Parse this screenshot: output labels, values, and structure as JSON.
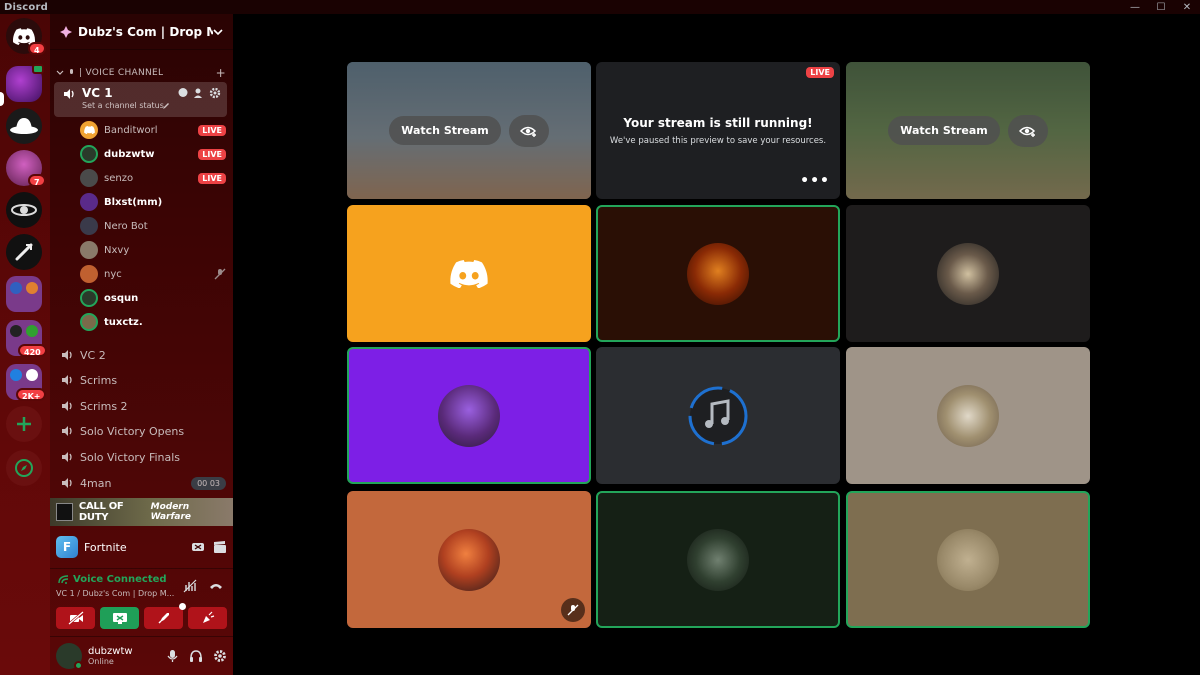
{
  "app": {
    "title": "Discord"
  },
  "servers": [
    {
      "name": "home",
      "badge": "4"
    },
    {
      "name": "server-2",
      "badge": ""
    },
    {
      "name": "server-3",
      "badge": ""
    },
    {
      "name": "server-4",
      "badge": "7"
    },
    {
      "name": "server-5",
      "badge": ""
    },
    {
      "name": "server-6",
      "badge": ""
    },
    {
      "name": "server-7",
      "badge": ""
    },
    {
      "name": "server-folder-1",
      "badge": "420"
    },
    {
      "name": "server-folder-2",
      "badge": "2K+"
    }
  ],
  "server_header": {
    "name": "Dubz's Com | Drop M..."
  },
  "category": {
    "label": "| VOICE CHANNEL"
  },
  "active_channel": {
    "name": "VC 1",
    "status": "Set a channel status"
  },
  "members": [
    {
      "name": "Banditworl",
      "live": "LIVE",
      "color": "#f0a232"
    },
    {
      "name": "dubzwtw",
      "live": "LIVE",
      "color": "#2a3a2a"
    },
    {
      "name": "senzo",
      "live": "LIVE",
      "color": "#4a4a4a"
    },
    {
      "name": "Blxst(mm)",
      "live": "",
      "color": "#5a2a8a"
    },
    {
      "name": "Nero Bot",
      "live": "",
      "color": "#3a3a4a"
    },
    {
      "name": "Nxvy",
      "live": "",
      "color": "#8a7a6a"
    },
    {
      "name": "nyc",
      "live": "",
      "color": "#c06030"
    },
    {
      "name": "osqun",
      "live": "",
      "color": "#2a3a2a"
    },
    {
      "name": "tuxctz.",
      "live": "",
      "color": "#7a6a4a"
    }
  ],
  "channels": [
    {
      "name": "VC 2"
    },
    {
      "name": "Scrims"
    },
    {
      "name": "Scrims 2"
    },
    {
      "name": "Solo Victory Opens"
    },
    {
      "name": "Solo Victory Finals"
    },
    {
      "name": "4man",
      "counts": "00 03"
    }
  ],
  "game_banner": {
    "title": "CALL OF DUTY",
    "subtitle": "Modern Warfare"
  },
  "activity": {
    "name": "Fortnite"
  },
  "voice": {
    "status": "Voice Connected",
    "channel": "VC 1 / Dubz's Com | Drop M..."
  },
  "user": {
    "name": "dubzwtw",
    "status": "Online"
  },
  "streams": {
    "watch_label": "Watch Stream",
    "live_label": "LIVE",
    "paused_title": "Your stream is still running!",
    "paused_sub": "We've paused this preview to save your resources.",
    "more": "•••"
  },
  "colors": {
    "accent_green": "#23a55a",
    "live_red": "#ed4245",
    "tile_orange": "#f6a21e",
    "tile_purple": "#7d1fe6",
    "tile_rust": "#c3683c"
  }
}
